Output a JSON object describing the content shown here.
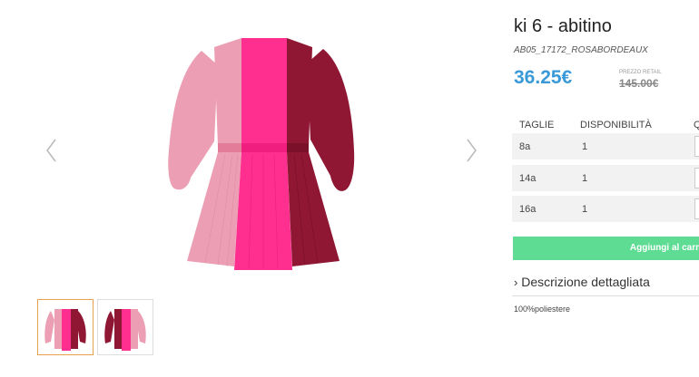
{
  "product": {
    "title": "ki 6 - abitino",
    "sku": "AB05_17172_ROSABORDEAUX",
    "price": "36.25€",
    "retail_label": "PREZZO RETAIL",
    "retail_price": "145.00€",
    "colors": {
      "price": "#3a9ad9",
      "button": "#5fdc93",
      "light_pink": "#ec9fb4",
      "hot_pink": "#ff2f8f",
      "bordeaux": "#8f1733"
    }
  },
  "gallery": {
    "prev_icon": "chevron-left-icon",
    "next_icon": "chevron-right-icon",
    "thumbnails": [
      "dress-front",
      "dress-back"
    ]
  },
  "sizes_table": {
    "headers": [
      "TAGLIE",
      "DISPONIBILITÀ",
      "Q"
    ],
    "rows": [
      {
        "size": "8a",
        "availability": "1"
      },
      {
        "size": "14a",
        "availability": "1"
      },
      {
        "size": "16a",
        "availability": "1"
      }
    ]
  },
  "cart_button": "Aggiungi al carr",
  "description": {
    "toggle_label": "Descrizione dettagliata",
    "toggle_icon": "chevron-right-icon",
    "material": "100%poliestere"
  }
}
